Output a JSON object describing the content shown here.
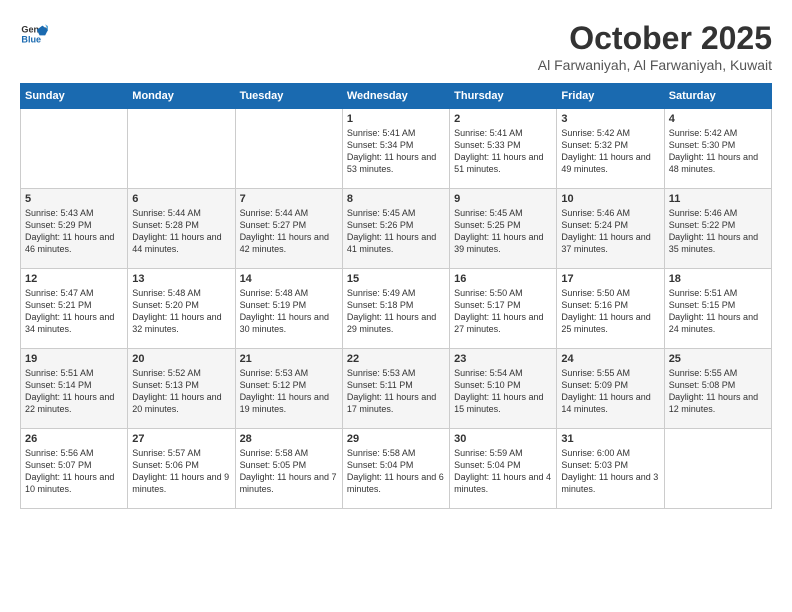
{
  "logo": {
    "line1": "General",
    "line2": "Blue"
  },
  "title": "October 2025",
  "subtitle": "Al Farwaniyah, Al Farwaniyah, Kuwait",
  "weekdays": [
    "Sunday",
    "Monday",
    "Tuesday",
    "Wednesday",
    "Thursday",
    "Friday",
    "Saturday"
  ],
  "weeks": [
    [
      {
        "day": "",
        "sunrise": "",
        "sunset": "",
        "daylight": ""
      },
      {
        "day": "",
        "sunrise": "",
        "sunset": "",
        "daylight": ""
      },
      {
        "day": "",
        "sunrise": "",
        "sunset": "",
        "daylight": ""
      },
      {
        "day": "1",
        "sunrise": "Sunrise: 5:41 AM",
        "sunset": "Sunset: 5:34 PM",
        "daylight": "Daylight: 11 hours and 53 minutes."
      },
      {
        "day": "2",
        "sunrise": "Sunrise: 5:41 AM",
        "sunset": "Sunset: 5:33 PM",
        "daylight": "Daylight: 11 hours and 51 minutes."
      },
      {
        "day": "3",
        "sunrise": "Sunrise: 5:42 AM",
        "sunset": "Sunset: 5:32 PM",
        "daylight": "Daylight: 11 hours and 49 minutes."
      },
      {
        "day": "4",
        "sunrise": "Sunrise: 5:42 AM",
        "sunset": "Sunset: 5:30 PM",
        "daylight": "Daylight: 11 hours and 48 minutes."
      }
    ],
    [
      {
        "day": "5",
        "sunrise": "Sunrise: 5:43 AM",
        "sunset": "Sunset: 5:29 PM",
        "daylight": "Daylight: 11 hours and 46 minutes."
      },
      {
        "day": "6",
        "sunrise": "Sunrise: 5:44 AM",
        "sunset": "Sunset: 5:28 PM",
        "daylight": "Daylight: 11 hours and 44 minutes."
      },
      {
        "day": "7",
        "sunrise": "Sunrise: 5:44 AM",
        "sunset": "Sunset: 5:27 PM",
        "daylight": "Daylight: 11 hours and 42 minutes."
      },
      {
        "day": "8",
        "sunrise": "Sunrise: 5:45 AM",
        "sunset": "Sunset: 5:26 PM",
        "daylight": "Daylight: 11 hours and 41 minutes."
      },
      {
        "day": "9",
        "sunrise": "Sunrise: 5:45 AM",
        "sunset": "Sunset: 5:25 PM",
        "daylight": "Daylight: 11 hours and 39 minutes."
      },
      {
        "day": "10",
        "sunrise": "Sunrise: 5:46 AM",
        "sunset": "Sunset: 5:24 PM",
        "daylight": "Daylight: 11 hours and 37 minutes."
      },
      {
        "day": "11",
        "sunrise": "Sunrise: 5:46 AM",
        "sunset": "Sunset: 5:22 PM",
        "daylight": "Daylight: 11 hours and 35 minutes."
      }
    ],
    [
      {
        "day": "12",
        "sunrise": "Sunrise: 5:47 AM",
        "sunset": "Sunset: 5:21 PM",
        "daylight": "Daylight: 11 hours and 34 minutes."
      },
      {
        "day": "13",
        "sunrise": "Sunrise: 5:48 AM",
        "sunset": "Sunset: 5:20 PM",
        "daylight": "Daylight: 11 hours and 32 minutes."
      },
      {
        "day": "14",
        "sunrise": "Sunrise: 5:48 AM",
        "sunset": "Sunset: 5:19 PM",
        "daylight": "Daylight: 11 hours and 30 minutes."
      },
      {
        "day": "15",
        "sunrise": "Sunrise: 5:49 AM",
        "sunset": "Sunset: 5:18 PM",
        "daylight": "Daylight: 11 hours and 29 minutes."
      },
      {
        "day": "16",
        "sunrise": "Sunrise: 5:50 AM",
        "sunset": "Sunset: 5:17 PM",
        "daylight": "Daylight: 11 hours and 27 minutes."
      },
      {
        "day": "17",
        "sunrise": "Sunrise: 5:50 AM",
        "sunset": "Sunset: 5:16 PM",
        "daylight": "Daylight: 11 hours and 25 minutes."
      },
      {
        "day": "18",
        "sunrise": "Sunrise: 5:51 AM",
        "sunset": "Sunset: 5:15 PM",
        "daylight": "Daylight: 11 hours and 24 minutes."
      }
    ],
    [
      {
        "day": "19",
        "sunrise": "Sunrise: 5:51 AM",
        "sunset": "Sunset: 5:14 PM",
        "daylight": "Daylight: 11 hours and 22 minutes."
      },
      {
        "day": "20",
        "sunrise": "Sunrise: 5:52 AM",
        "sunset": "Sunset: 5:13 PM",
        "daylight": "Daylight: 11 hours and 20 minutes."
      },
      {
        "day": "21",
        "sunrise": "Sunrise: 5:53 AM",
        "sunset": "Sunset: 5:12 PM",
        "daylight": "Daylight: 11 hours and 19 minutes."
      },
      {
        "day": "22",
        "sunrise": "Sunrise: 5:53 AM",
        "sunset": "Sunset: 5:11 PM",
        "daylight": "Daylight: 11 hours and 17 minutes."
      },
      {
        "day": "23",
        "sunrise": "Sunrise: 5:54 AM",
        "sunset": "Sunset: 5:10 PM",
        "daylight": "Daylight: 11 hours and 15 minutes."
      },
      {
        "day": "24",
        "sunrise": "Sunrise: 5:55 AM",
        "sunset": "Sunset: 5:09 PM",
        "daylight": "Daylight: 11 hours and 14 minutes."
      },
      {
        "day": "25",
        "sunrise": "Sunrise: 5:55 AM",
        "sunset": "Sunset: 5:08 PM",
        "daylight": "Daylight: 11 hours and 12 minutes."
      }
    ],
    [
      {
        "day": "26",
        "sunrise": "Sunrise: 5:56 AM",
        "sunset": "Sunset: 5:07 PM",
        "daylight": "Daylight: 11 hours and 10 minutes."
      },
      {
        "day": "27",
        "sunrise": "Sunrise: 5:57 AM",
        "sunset": "Sunset: 5:06 PM",
        "daylight": "Daylight: 11 hours and 9 minutes."
      },
      {
        "day": "28",
        "sunrise": "Sunrise: 5:58 AM",
        "sunset": "Sunset: 5:05 PM",
        "daylight": "Daylight: 11 hours and 7 minutes."
      },
      {
        "day": "29",
        "sunrise": "Sunrise: 5:58 AM",
        "sunset": "Sunset: 5:04 PM",
        "daylight": "Daylight: 11 hours and 6 minutes."
      },
      {
        "day": "30",
        "sunrise": "Sunrise: 5:59 AM",
        "sunset": "Sunset: 5:04 PM",
        "daylight": "Daylight: 11 hours and 4 minutes."
      },
      {
        "day": "31",
        "sunrise": "Sunrise: 6:00 AM",
        "sunset": "Sunset: 5:03 PM",
        "daylight": "Daylight: 11 hours and 3 minutes."
      },
      {
        "day": "",
        "sunrise": "",
        "sunset": "",
        "daylight": ""
      }
    ]
  ]
}
